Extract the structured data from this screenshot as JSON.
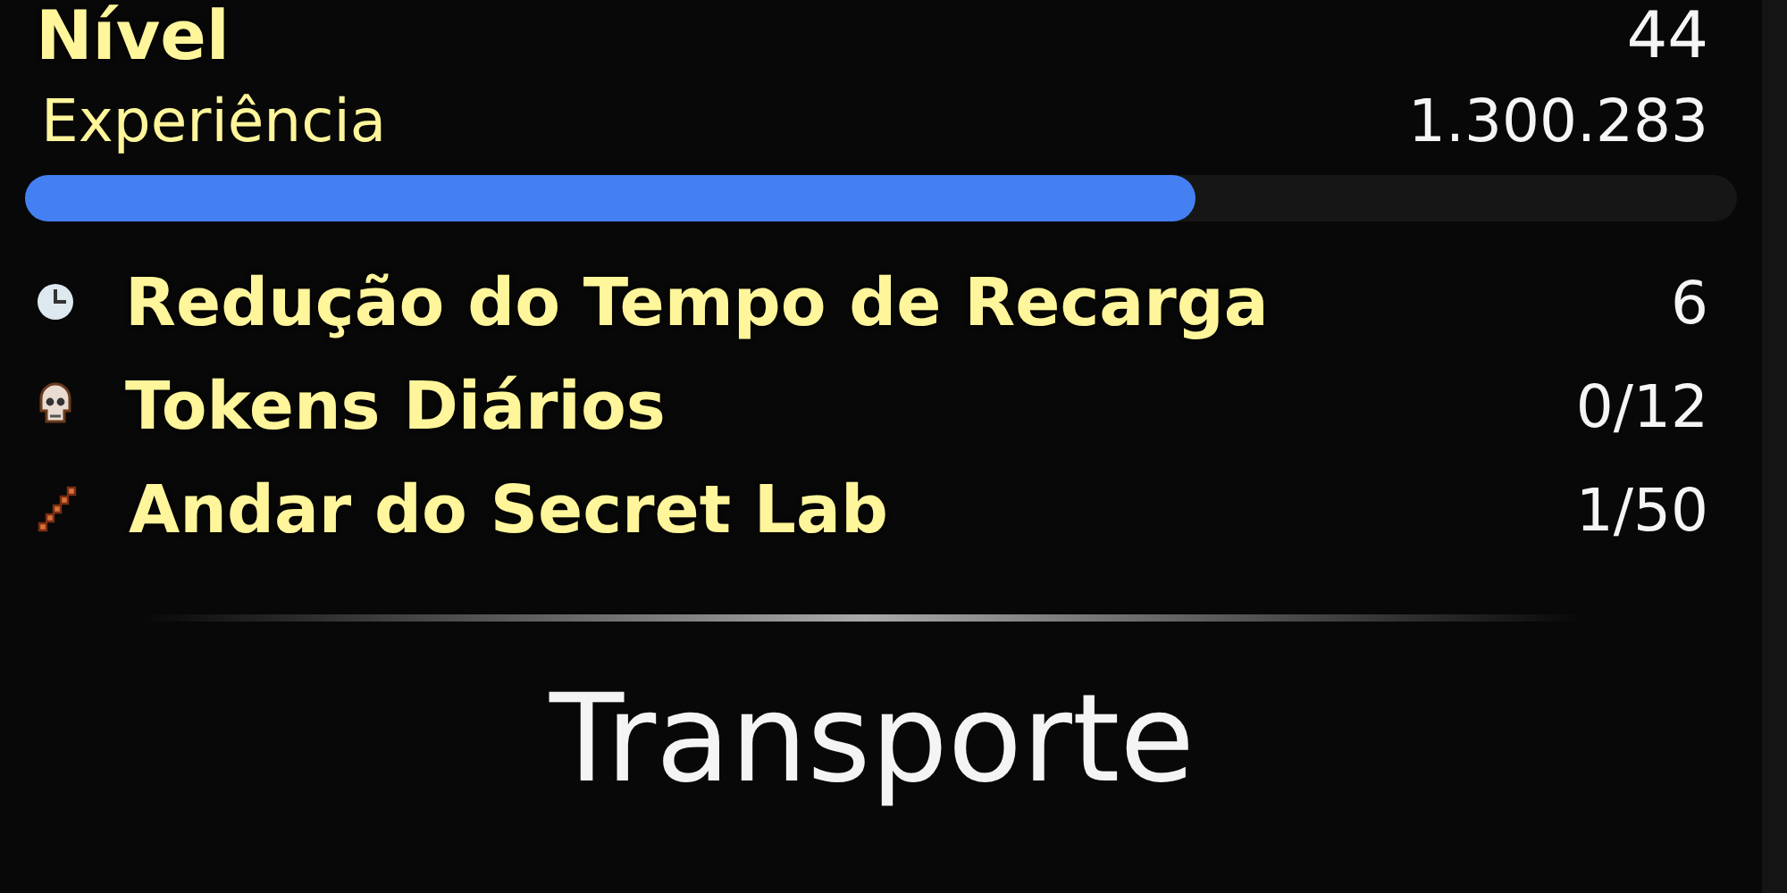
{
  "level_row": {
    "label": "Nível",
    "value": "44"
  },
  "experience": {
    "label": "Experiência",
    "value": "1.300.283",
    "level": 0.684
  },
  "stats": [
    {
      "kind": "clock",
      "label": "Redução do Tempo de Recarga",
      "value": "6"
    },
    {
      "kind": "skull",
      "label": "Tokens Diários",
      "value": "0/12"
    },
    {
      "kind": "stairs",
      "label": "Andar do Secret Lab",
      "value": "1/50"
    }
  ],
  "section_title": "Transporte"
}
